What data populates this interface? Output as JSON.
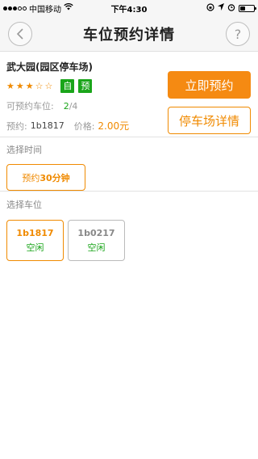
{
  "status_bar": {
    "carrier": "中国移动",
    "time": "下午4:30",
    "signal_full": 3,
    "signal_total": 5,
    "battery_level": 0.35
  },
  "nav": {
    "title": "车位预约详情",
    "back_icon": "‹",
    "help_icon": "?"
  },
  "lot": {
    "name": "武大园(园区停车场)",
    "rating": 3,
    "rating_max": 5,
    "tags": [
      "自",
      "预"
    ],
    "available_label": "可预约车位:",
    "available_num": "2",
    "available_total": "/4",
    "reserve_label": "预约:",
    "reserve_spot": "1b1817",
    "price_label": "价格:",
    "price_value": "2.00元",
    "reserve_button": "立即预约",
    "detail_button": "停车场详情"
  },
  "time_section": {
    "label": "选择时间",
    "chip_prefix": "预约",
    "chip_value": "30分钟"
  },
  "spot_section": {
    "label": "选择车位",
    "spots": [
      {
        "id": "1b1817",
        "status": "空闲",
        "selected": true
      },
      {
        "id": "1b0217",
        "status": "空闲",
        "selected": false
      }
    ]
  },
  "colors": {
    "accent": "#f58a12",
    "green": "#1aa51a"
  }
}
